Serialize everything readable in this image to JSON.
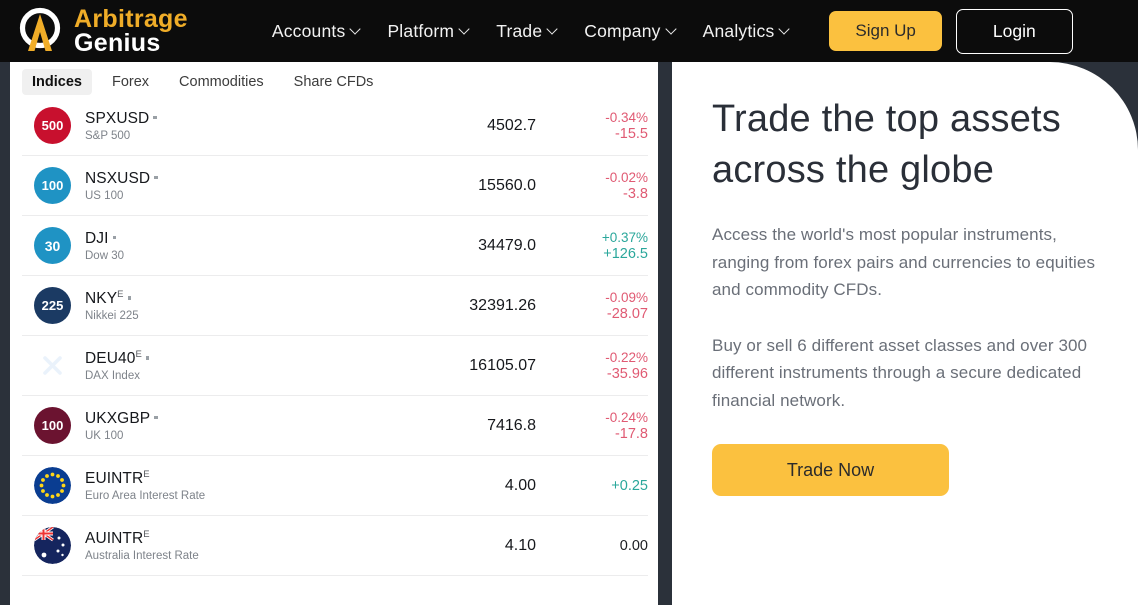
{
  "brand": {
    "line1": "Arbitrage",
    "line2": "Genius",
    "logo_icon": "arbitrage-genius-logo-icon",
    "accent": "#f0ad28"
  },
  "nav": {
    "items": [
      {
        "label": "Accounts",
        "caret": "chevron-down-icon"
      },
      {
        "label": "Platform",
        "caret": "chevron-down-icon"
      },
      {
        "label": "Trade",
        "caret": "chevron-down-icon"
      },
      {
        "label": "Company",
        "caret": "chevron-down-icon"
      },
      {
        "label": "Analytics",
        "caret": "chevron-down-icon"
      }
    ],
    "signup_label": "Sign Up",
    "login_label": "Login"
  },
  "market": {
    "tabs": [
      {
        "label": "Indices",
        "active": true
      },
      {
        "label": "Forex",
        "active": false
      },
      {
        "label": "Commodities",
        "active": false
      },
      {
        "label": "Share CFDs",
        "active": false
      }
    ],
    "rows": [
      {
        "badge_text": "500",
        "badge_color": "#c8102e",
        "badge_icon": "sp500-badge-icon",
        "symbol": "SPXUSD",
        "sup": "",
        "dot": true,
        "name": "S&P 500",
        "price": "4502.7",
        "pct": "-0.34%",
        "abs": "-15.5",
        "dir": "neg"
      },
      {
        "badge_text": "100",
        "badge_color": "#1f93c4",
        "badge_icon": "us100-badge-icon",
        "symbol": "NSXUSD",
        "sup": "",
        "dot": true,
        "name": "US 100",
        "price": "15560.0",
        "pct": "-0.02%",
        "abs": "-3.8",
        "dir": "neg"
      },
      {
        "badge_text": "30",
        "badge_color": "#1f93c4",
        "badge_icon": "dow30-badge-icon",
        "symbol": "DJI",
        "sup": "",
        "dot": true,
        "name": "Dow 30",
        "price": "34479.0",
        "pct": "+0.37%",
        "abs": "+126.5",
        "dir": "pos"
      },
      {
        "badge_text": "225",
        "badge_color": "#1b3a63",
        "badge_icon": "nikkei225-badge-icon",
        "symbol": "NKY",
        "sup": "E",
        "dot": true,
        "name": "Nikkei 225",
        "price": "32391.26",
        "pct": "-0.09%",
        "abs": "-28.07",
        "dir": "neg"
      },
      {
        "badge_text": "",
        "badge_color": "#2b6cb0",
        "badge_icon": "dax-x-badge-icon",
        "symbol": "DEU40",
        "sup": "E",
        "dot": true,
        "name": "DAX Index",
        "price": "16105.07",
        "pct": "-0.22%",
        "abs": "-35.96",
        "dir": "neg"
      },
      {
        "badge_text": "100",
        "badge_color": "#6b1330",
        "badge_icon": "uk100-badge-icon",
        "symbol": "UKXGBP",
        "sup": "",
        "dot": true,
        "name": "UK 100",
        "price": "7416.8",
        "pct": "-0.24%",
        "abs": "-17.8",
        "dir": "neg"
      },
      {
        "badge_text": "",
        "badge_color": "#0a3d91",
        "badge_icon": "eu-flag-icon",
        "symbol": "EUINTR",
        "sup": "E",
        "dot": false,
        "name": "Euro Area Interest Rate",
        "price": "4.00",
        "pct": "",
        "abs": "+0.25",
        "dir": "pos"
      },
      {
        "badge_text": "",
        "badge_color": "#15255e",
        "badge_icon": "au-flag-icon",
        "symbol": "AUINTR",
        "sup": "E",
        "dot": false,
        "name": "Australia Interest Rate",
        "price": "4.10",
        "pct": "",
        "abs": "0.00",
        "dir": "neu"
      }
    ]
  },
  "hero": {
    "title": "Trade the top assets across the globe",
    "paragraph1": "Access the world's most popular instruments, ranging from forex pairs and currencies to equities and commodity CFDs.",
    "paragraph2": "Buy or sell 6 different asset classes and over 300 different instruments through a secure dedicated financial network.",
    "cta_label": "Trade Now",
    "cta_color": "#fbc13f"
  }
}
